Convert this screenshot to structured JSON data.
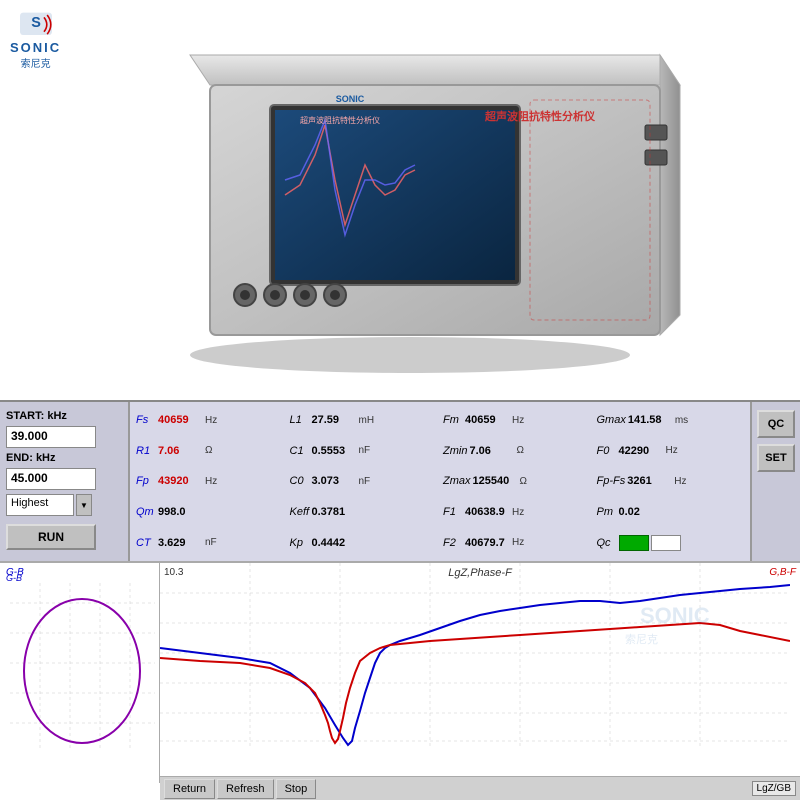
{
  "logo": {
    "brand": "SONIC",
    "sub": "索尼克"
  },
  "device": {
    "title": "超声波阻抗特性分析仪"
  },
  "controls": {
    "start_label": "START: kHz",
    "start_value": "39.000",
    "end_label": "END:   kHz",
    "end_value": "45.000",
    "mode_label": "Highest",
    "run_label": "RUN"
  },
  "qc": {
    "qc_label": "QC",
    "set_label": "SET"
  },
  "params": [
    {
      "name": "Fs",
      "name_color": "blue",
      "value": "40659",
      "value_color": "red",
      "unit": "Hz"
    },
    {
      "name": "L1",
      "name_color": "black",
      "value": "27.59",
      "value_color": "black",
      "unit": "mH"
    },
    {
      "name": "Fm",
      "name_color": "black",
      "value": "40659",
      "value_color": "black",
      "unit": "Hz"
    },
    {
      "name": "Gmax",
      "name_color": "black",
      "value": "141.58",
      "value_color": "black",
      "unit": "ms"
    },
    {
      "name": "R1",
      "name_color": "blue",
      "value": "7.06",
      "value_color": "red",
      "unit": "Ω"
    },
    {
      "name": "C1",
      "name_color": "black",
      "value": "0.5553",
      "value_color": "black",
      "unit": "nF"
    },
    {
      "name": "Zmin",
      "name_color": "black",
      "value": "7.06",
      "value_color": "black",
      "unit": "Ω"
    },
    {
      "name": "F0",
      "name_color": "black",
      "value": "42290",
      "value_color": "black",
      "unit": "Hz"
    },
    {
      "name": "Fp",
      "name_color": "blue",
      "value": "43920",
      "value_color": "red",
      "unit": "Hz"
    },
    {
      "name": "C0",
      "name_color": "black",
      "value": "3.073",
      "value_color": "black",
      "unit": "nF"
    },
    {
      "name": "Zmax",
      "name_color": "black",
      "value": "125540",
      "value_color": "black",
      "unit": "Ω"
    },
    {
      "name": "Fp-Fs",
      "name_color": "black",
      "value": "3261",
      "value_color": "black",
      "unit": "Hz"
    },
    {
      "name": "Qm",
      "name_color": "blue",
      "value": "998.0",
      "value_color": "black",
      "unit": ""
    },
    {
      "name": "Keff",
      "name_color": "black",
      "value": "0.3781",
      "value_color": "black",
      "unit": ""
    },
    {
      "name": "F1",
      "name_color": "black",
      "value": "40638.9",
      "value_color": "black",
      "unit": "Hz"
    },
    {
      "name": "Pm",
      "name_color": "black",
      "value": "0.02",
      "value_color": "black",
      "unit": ""
    },
    {
      "name": "CT",
      "name_color": "blue",
      "value": "3.629",
      "value_color": "black",
      "unit": "nF"
    },
    {
      "name": "Kp",
      "name_color": "black",
      "value": "0.4442",
      "value_color": "black",
      "unit": ""
    },
    {
      "name": "F2",
      "name_color": "black",
      "value": "40679.7",
      "value_color": "black",
      "unit": "Hz"
    },
    {
      "name": "Qc",
      "name_color": "black",
      "value": "",
      "value_color": "black",
      "unit": ""
    }
  ],
  "chart": {
    "scale": "10.3",
    "title": "LgZ,Phase-F",
    "right_label": "G,B-F",
    "left_label": "G-B",
    "lgz_label": "LgZ/GB",
    "bottom_btns": [
      "Return",
      "Refresh",
      "Stop"
    ]
  }
}
